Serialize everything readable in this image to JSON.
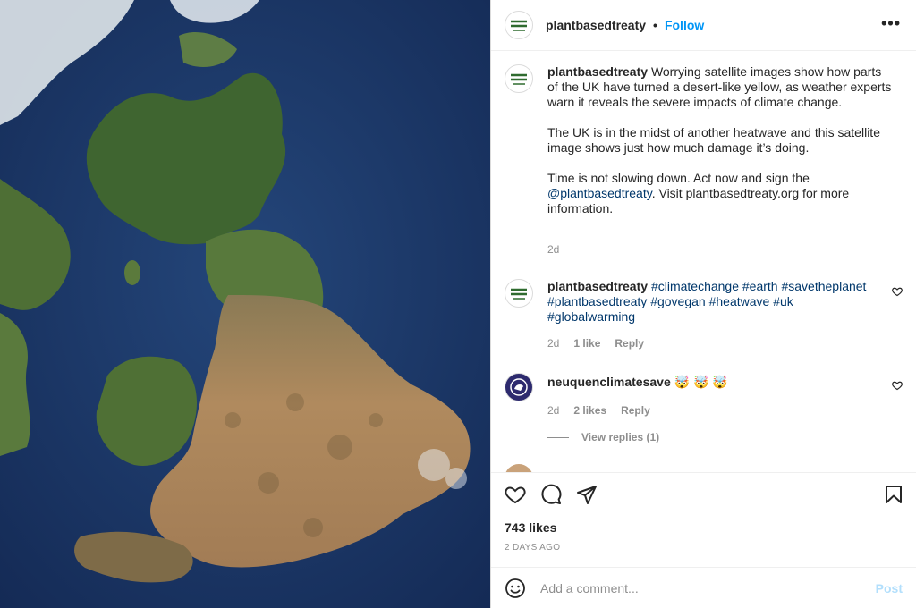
{
  "post": {
    "author": "plantbasedtreaty",
    "follow_label": "Follow",
    "separator": "•",
    "more_label": "•••"
  },
  "caption": {
    "username": "plantbasedtreaty",
    "para1": "Worrying satellite images show how parts of the UK have turned a desert-like yellow, as weather experts warn it reveals the severe impacts of climate change.",
    "para2": "The UK is in the midst of another heatwave and this satellite image shows just how much damage it’s doing.",
    "para3_start": "Time is not slowing down. Act now and sign the ",
    "para3_mention": "@plantbasedtreaty",
    "para3_end": ". Visit plantbasedtreaty.org for more information.",
    "age": "2d"
  },
  "comments": [
    {
      "username": "plantbasedtreaty",
      "text": "#climatechange #earth #savetheplanet #plantbasedtreaty #govegan #heatwave #uk #globalwarming",
      "age": "2d",
      "likes": "1 like",
      "reply": "Reply"
    },
    {
      "username": "neuquenclimatesave",
      "text": "🤯 🤯 🤯",
      "age": "2d",
      "likes": "2 likes",
      "reply": "Reply"
    }
  ],
  "view_replies": "View replies (1)",
  "footer": {
    "likes": "743 likes",
    "age": "2 DAYS AGO",
    "comment_placeholder": "Add a comment...",
    "post_label": "Post"
  },
  "icons": {
    "like": "heart-icon",
    "comment": "comment-icon",
    "share": "paper-plane-icon",
    "save": "bookmark-icon",
    "emoji": "smiley-icon"
  },
  "colors": {
    "accent": "#0095f6",
    "hashtag": "#00376b",
    "muted": "#8e8e8e",
    "post_disabled": "#b2dffc"
  }
}
